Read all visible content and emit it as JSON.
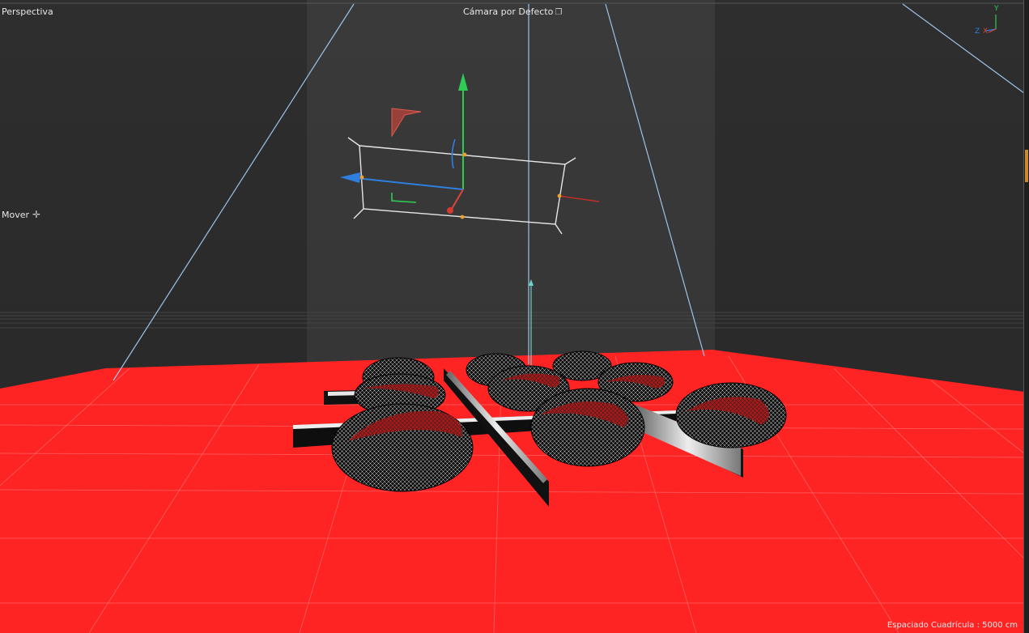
{
  "viewport": {
    "view_name": "Perspectiva",
    "camera_label": "Cámara por Defecto",
    "camera_icon": "camera-icon",
    "tool_label": "Mover",
    "tool_icon": "move-cross-icon",
    "grid_spacing": "Espaciado Cuadrícula : 5000 cm",
    "axis_labels": {
      "y": "Y",
      "z": "Z",
      "x": "X"
    }
  },
  "colors": {
    "background": "#2b2b2b",
    "floor": "#ff2424",
    "axis_x": "#e0443a",
    "axis_y": "#2ecc55",
    "axis_z": "#2f7fe0",
    "guide_lines": "#9cc3e8"
  }
}
